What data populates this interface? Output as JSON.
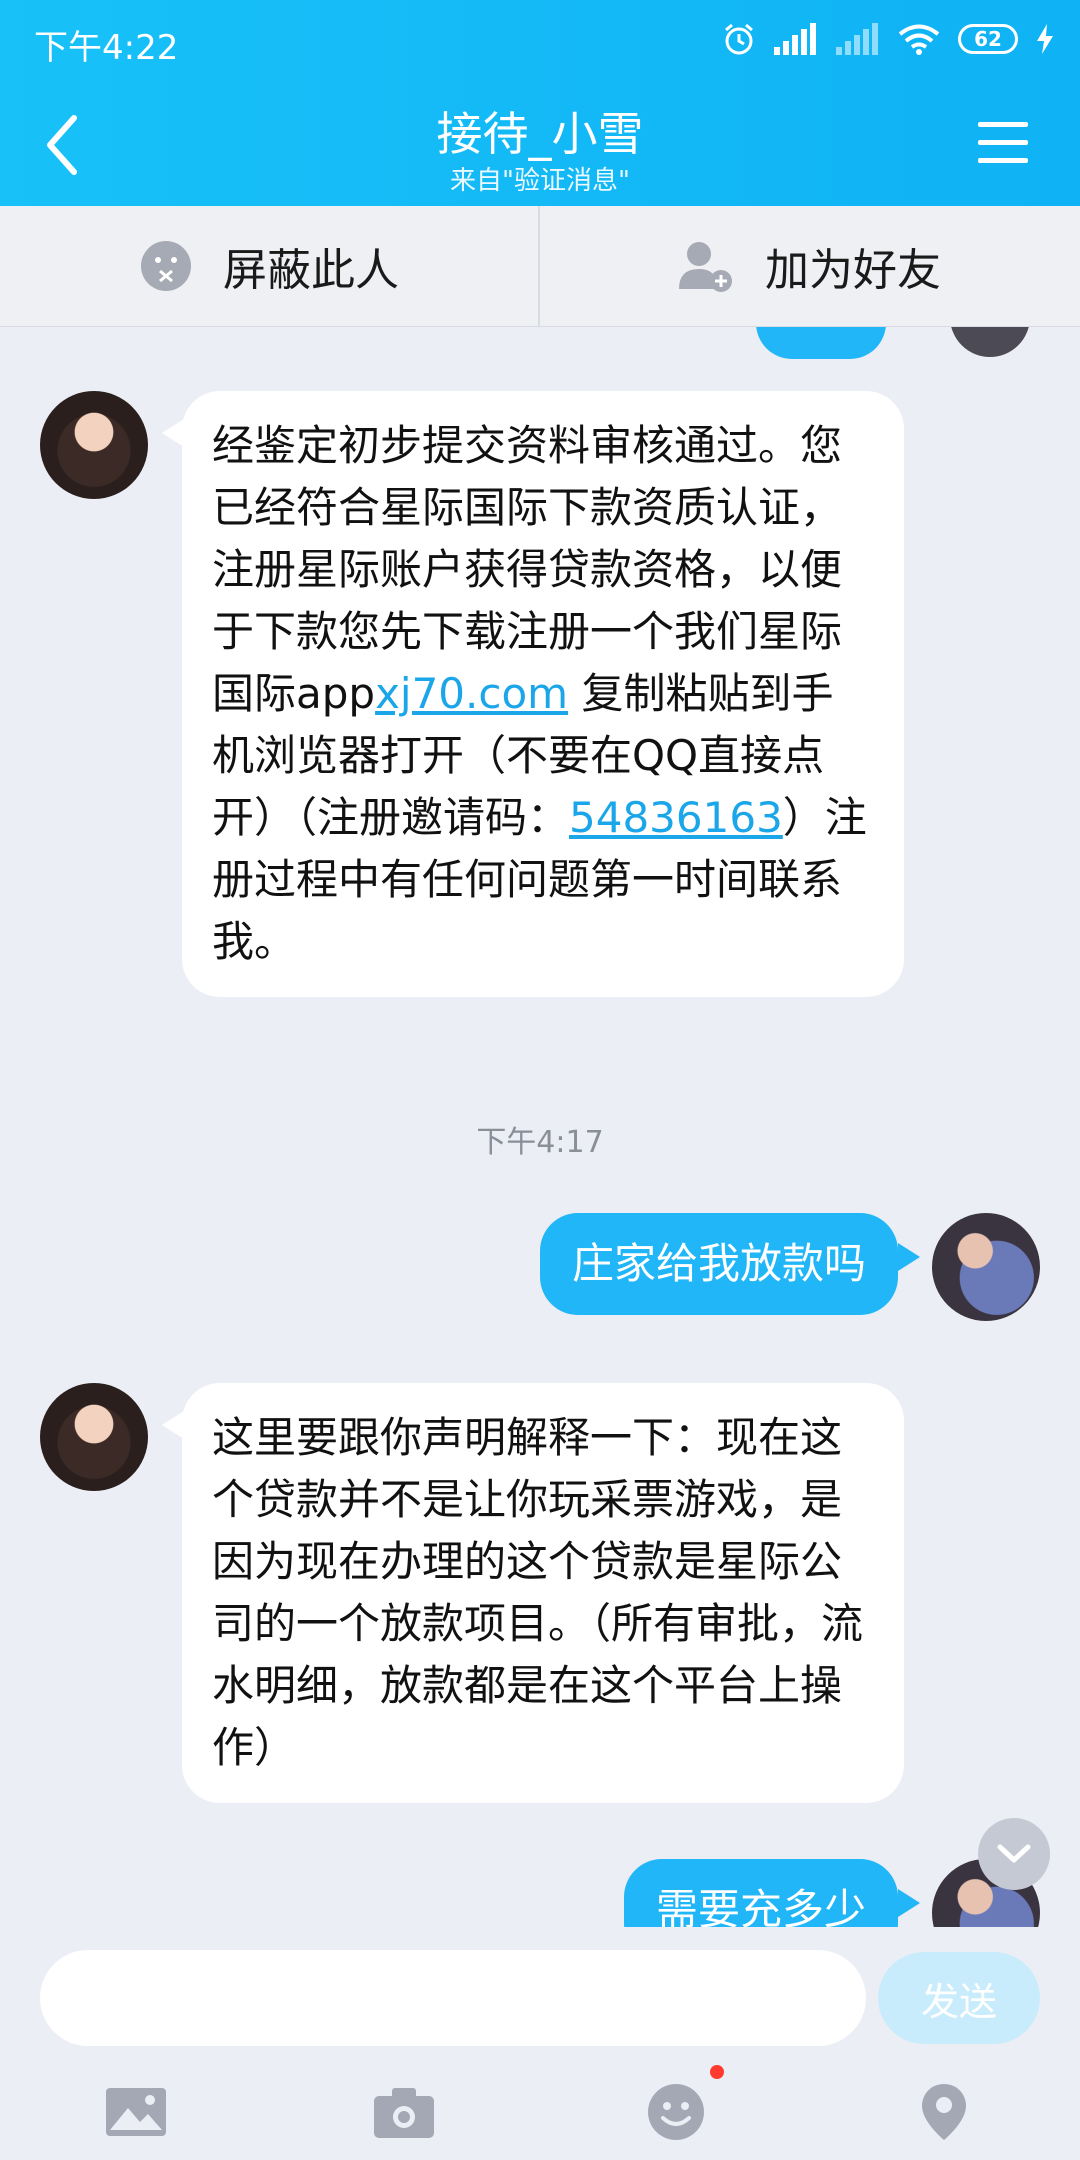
{
  "status_bar": {
    "time": "下午4:22",
    "battery": "62"
  },
  "header": {
    "title": "接待_小雪",
    "subtitle": "来自\"验证消息\""
  },
  "actions": {
    "block_label": "屏蔽此人",
    "add_friend_label": "加为好友"
  },
  "messages": {
    "m1": {
      "part1": "经鉴定初步提交资料审核通过。您已经符合星际国际下款资质认证，注册星际账户获得贷款资格，以便于下款您先下载注册一个我们星际国际app",
      "link": "xj70.com",
      "part2": " 复制粘贴到手机浏览器打开（不要在QQ直接点开）（注册邀请码：",
      "code": "54836163",
      "part3": "）注册过程中有任何问题第一时间联系我。"
    },
    "timestamp": "下午4:17",
    "m2": "庄家给我放款吗",
    "m3": "这里要跟你声明解释一下：现在这个贷款并不是让你玩采票游戏，是因为现在办理的这个贷款是星际公司的一个放款项目。（所有审批，流水明细，放款都是在这个平台上操作）",
    "m4": "需要充多少"
  },
  "composer": {
    "placeholder": "",
    "send_label": "发送"
  },
  "colors": {
    "header": "#18c1f8",
    "out_bubble": "#20b6f7",
    "link": "#1aa6e8"
  }
}
